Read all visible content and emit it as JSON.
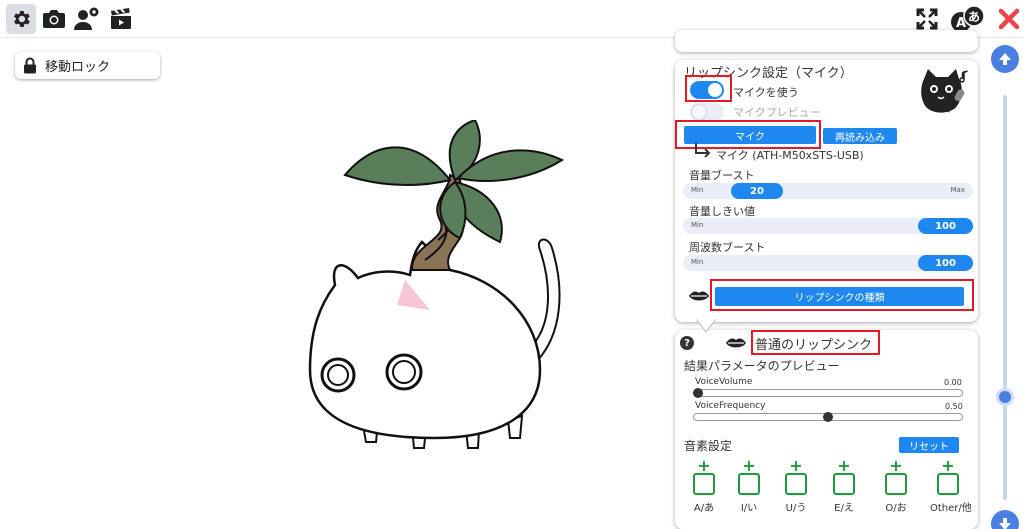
{
  "toolbar": {
    "left_icons": [
      "gear-icon",
      "camera-icon",
      "user-settings-icon",
      "clapperboard-icon"
    ],
    "right_icons": [
      "fullscreen-icon",
      "language-icon",
      "close-icon"
    ],
    "language_glyph_a": "A",
    "language_glyph_jp": "あ"
  },
  "lock_button": {
    "label": "移動ロック"
  },
  "lipsync": {
    "title": "リップシンク設定（マイク）",
    "use_mic_label": "マイクを使う",
    "use_mic_on": true,
    "preview_label": "マイクプレビュー",
    "preview_on": false,
    "mic_button_label": "マイク",
    "reload_button_label": "再読み込み",
    "mic_device": "マイク (ATH-M50xSTS-USB)",
    "sliders": [
      {
        "label": "音量ブースト",
        "min_label": "Min",
        "max_label": "Max",
        "value": "20",
        "level": 0.2
      },
      {
        "label": "音量しきい値",
        "min_label": "Min",
        "max_label": "",
        "value": "100",
        "level": 1.0
      },
      {
        "label": "周波数ブースト",
        "min_label": "Min",
        "max_label": "",
        "value": "100",
        "level": 1.0
      }
    ],
    "type_button_label": "リップシンクの種類"
  },
  "result": {
    "help_glyph": "?",
    "type_name": "普通のリップシンク",
    "preview_title": "結果パラメータのプレビュー",
    "params": [
      {
        "name": "VoiceVolume",
        "value": "0.00",
        "level": 0.0
      },
      {
        "name": "VoiceFrequency",
        "value": "0.50",
        "level": 0.5
      }
    ],
    "phoneme_title": "音素設定",
    "reset_label": "リセット",
    "phonemes": [
      "A/あ",
      "I/い",
      "U/う",
      "E/え",
      "O/お",
      "Other/他"
    ]
  },
  "colors": {
    "accent": "#1e88f0",
    "scroll": "#4a7ee0",
    "highlight": "#e0192b",
    "phoneme": "#1e9c3c",
    "close": "#e8464a"
  }
}
